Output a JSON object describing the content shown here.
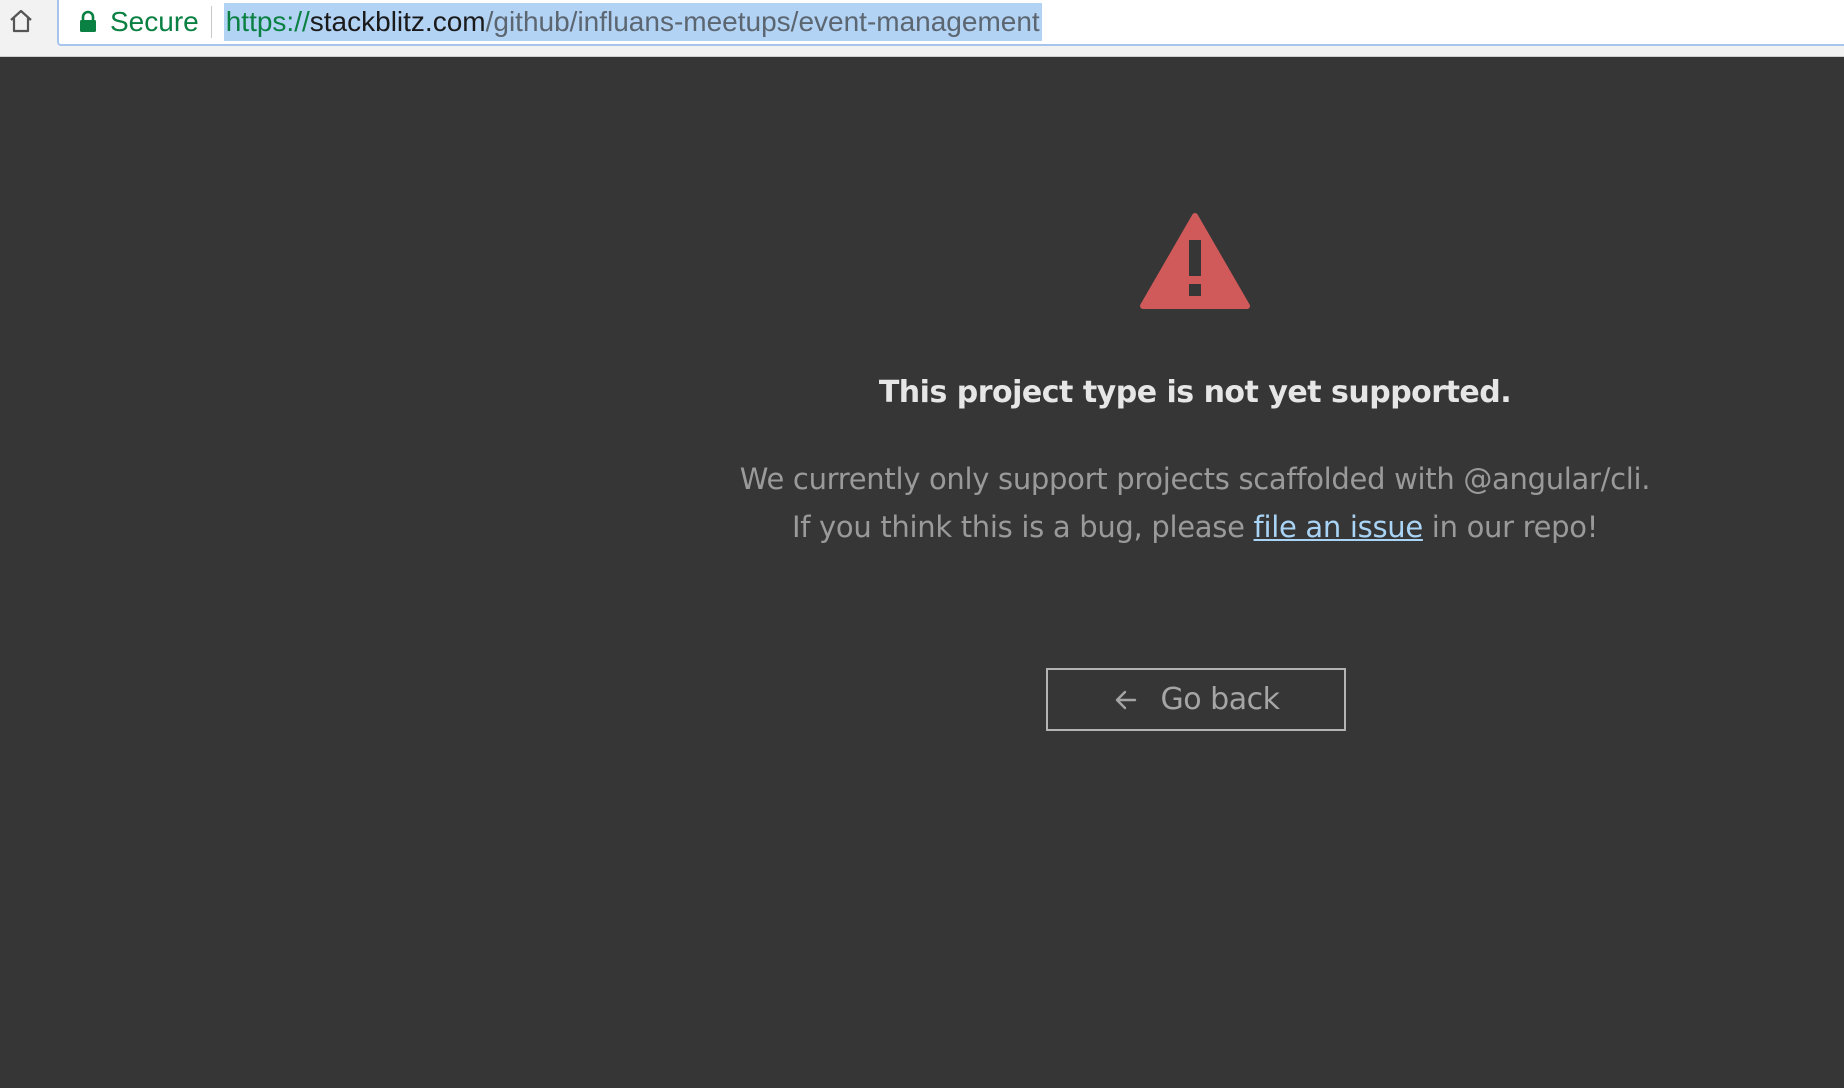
{
  "browser": {
    "home_icon": "home-icon",
    "lock_icon": "lock-icon",
    "security_label": "Secure",
    "url": {
      "scheme": "https://",
      "host": "stackblitz.com",
      "path": "/github/influans-meetups/event-management"
    }
  },
  "error_page": {
    "icon": "warning-triangle-icon",
    "icon_color": "#d05a5a",
    "title": "This project type is not yet supported.",
    "line1": "We currently only support projects scaffolded with @angular/cli.",
    "line2_before": "If you think this is a bug, please ",
    "link_text": "file an issue",
    "line2_after": " in our repo!",
    "link_color": "#a9d4f5",
    "back_button_label": "Go back",
    "back_icon": "arrow-left-icon"
  }
}
